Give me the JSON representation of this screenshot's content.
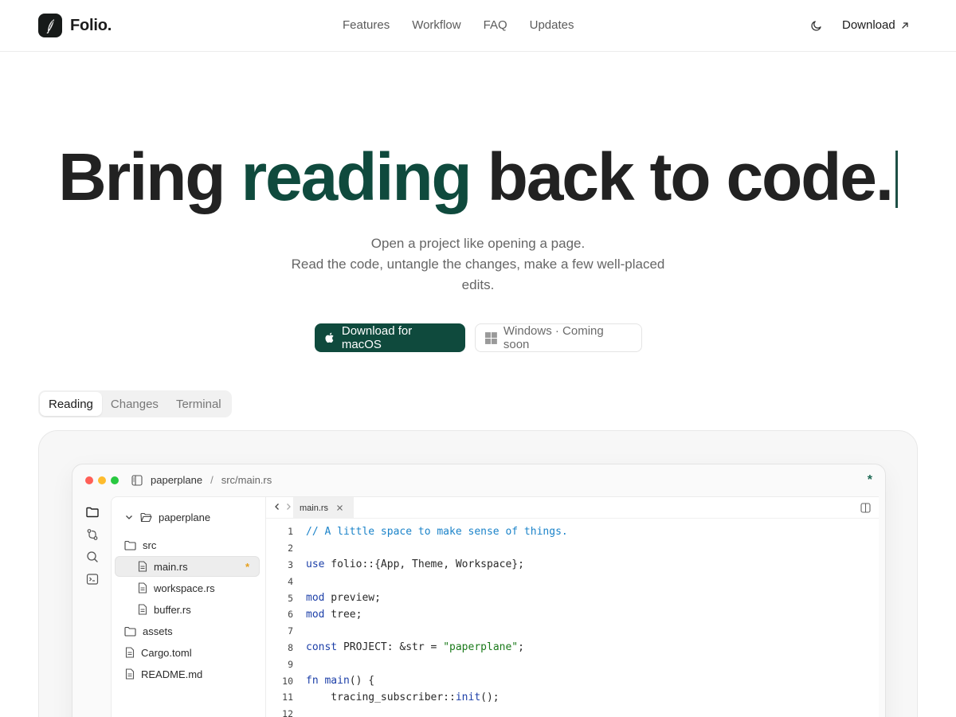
{
  "header": {
    "brand": "Folio.",
    "nav": [
      "Features",
      "Workflow",
      "FAQ",
      "Updates"
    ],
    "download_label": "Download"
  },
  "hero": {
    "title_part1": "Bring ",
    "title_accent": "reading",
    "title_part2": " back to code.",
    "subtitle_line1": "Open a project like opening a page.",
    "subtitle_line2": "Read the code, untangle the changes, make a few well-placed edits.",
    "cta_primary": "Download for macOS",
    "cta_secondary": "Windows · Coming soon"
  },
  "modes": {
    "tabs": [
      "Reading",
      "Changes",
      "Terminal"
    ],
    "active": "Reading"
  },
  "colors": {
    "accent": "#0f4a3d",
    "modified": "#e6a01e"
  },
  "app": {
    "breadcrumb_project": "paperplane",
    "breadcrumb_sep": "/",
    "breadcrumb_path": "src/main.rs",
    "status_marker": "*",
    "activity_icons": [
      "folder-icon",
      "git-branch-icon",
      "search-icon",
      "terminal-icon"
    ],
    "tree": [
      {
        "label": "paperplane",
        "type": "folder-open",
        "depth": 0
      },
      {
        "label": "src",
        "type": "folder",
        "depth": 0
      },
      {
        "label": "main.rs",
        "type": "file",
        "depth": 1,
        "selected": true,
        "modified": true
      },
      {
        "label": "workspace.rs",
        "type": "file",
        "depth": 1
      },
      {
        "label": "buffer.rs",
        "type": "file",
        "depth": 1
      },
      {
        "label": "assets",
        "type": "folder",
        "depth": 0
      },
      {
        "label": "Cargo.toml",
        "type": "file",
        "depth": 0
      },
      {
        "label": "README.md",
        "type": "file",
        "depth": 0
      }
    ],
    "modified_marker": "*",
    "open_tab": "main.rs",
    "code_lines": [
      {
        "n": "1",
        "text": "// A little space to make sense of things."
      },
      {
        "n": "2",
        "text": ""
      },
      {
        "n": "3",
        "text": "use folio::{App, Theme, Workspace};"
      },
      {
        "n": "4",
        "text": ""
      },
      {
        "n": "5",
        "text": "mod preview;"
      },
      {
        "n": "6",
        "text": "mod tree;"
      },
      {
        "n": "7",
        "text": ""
      },
      {
        "n": "8",
        "text": "const PROJECT: &str = \"paperplane\";"
      },
      {
        "n": "9",
        "text": ""
      },
      {
        "n": "10",
        "text": "fn main() {"
      },
      {
        "n": "11",
        "text": "    tracing_subscriber::init();"
      },
      {
        "n": "12",
        "text": ""
      }
    ]
  }
}
